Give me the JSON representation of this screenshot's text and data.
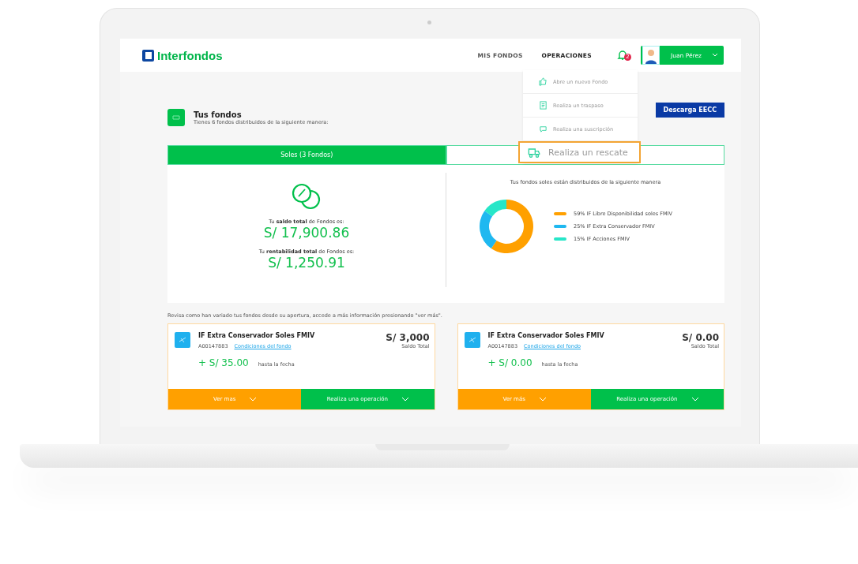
{
  "header": {
    "logo": "Interfondos",
    "nav": [
      {
        "label": "MIS FONDOS",
        "selected": false
      },
      {
        "label": "OPERACIONES",
        "selected": true
      }
    ],
    "notifications": "2",
    "user": "Juan Pérez"
  },
  "operations_menu": [
    {
      "label": "Abre un nuevo Fondo",
      "kind": "thumb",
      "selected": false
    },
    {
      "label": "Realiza un traspaso",
      "kind": "doc",
      "selected": false
    },
    {
      "label": "Realiza una suscripción",
      "kind": "chat",
      "selected": false
    },
    {
      "label": "Realiza un rescate",
      "kind": "truck",
      "selected": true
    }
  ],
  "summary": {
    "title": "Tus fondos",
    "subtitle": "Tienes 6 fondos distribuidos de la siguiente manera:",
    "download_button": "Descarga EECC"
  },
  "tabs": [
    {
      "label": "Soles (3 Fondos)",
      "selected": true
    },
    {
      "selected": false
    }
  ],
  "balance": {
    "saldo_label": "Tu **saldo total** de Fondos es:",
    "saldo": "S/ 17,900.86",
    "rentabilidad_label": "Tu **rentabilidad total** de Fondos es:",
    "rentabilidad": "S/ 1,250.91"
  },
  "distribution": {
    "chart_data": {
      "type": "donut",
      "title": "Tus fondos soles están distribuidos de la siguiente manera",
      "categories": [
        "59% IF Libre Disponibilidad soles FMIV",
        "25% IF Extra Conservador FMIV",
        "15% IF Acciones FMIV"
      ],
      "series": [
        {
          "values": [
            59,
            25,
            15
          ]
        }
      ],
      "legend": "right",
      "colors": [
        "#ffa000",
        "#1fb8f0",
        "#27e6c8"
      ]
    }
  },
  "note": "Revisa como han variado tus fondos desde su apertura, accede a más información presionando \"ver más\".",
  "funds": [
    {
      "name": "IF Extra Conservador Soles FMIV",
      "code": "A00147883",
      "link": "Condiciones del fondo",
      "amount": "S/ 3,000",
      "amount_label": "Saldo Total",
      "gain": "+ S/ 35.00",
      "gain_label": "hasta la fecha",
      "more": "Ver mas",
      "operation": "Realiza una operación"
    },
    {
      "name": "IF Extra Conservador Soles FMIV",
      "code": "A00147883",
      "link": "Condiciones del fondo",
      "amount": "S/ 0.00",
      "amount_label": "Saldo Total",
      "gain": "+ S/ 0.00",
      "gain_label": "hasta la fecha",
      "more": "Ver más",
      "operation": "Realiza una operación"
    }
  ]
}
